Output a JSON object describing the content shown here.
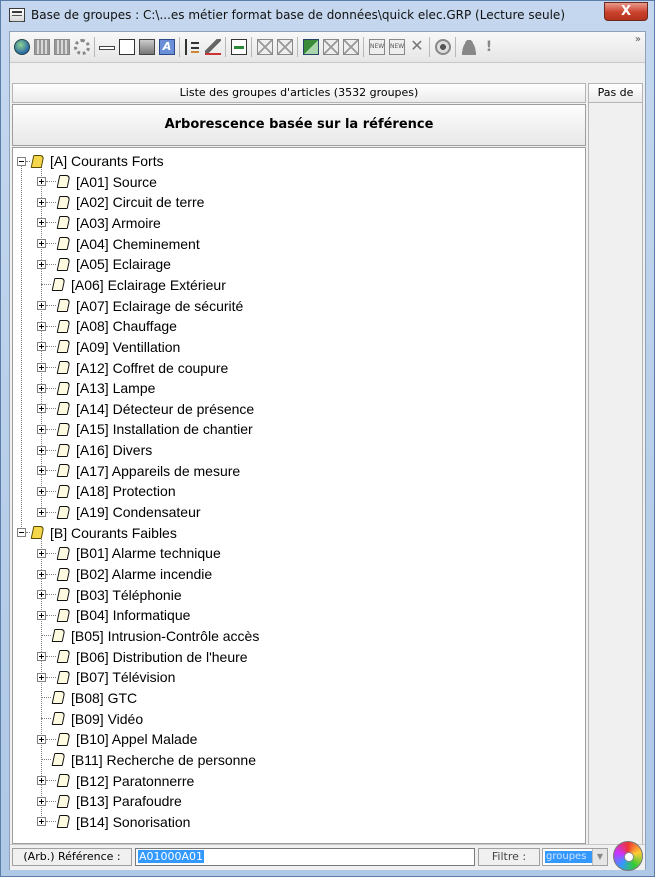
{
  "window": {
    "title": "Base de groupes : C:\\...es métier format base de données\\quick elec.GRP (Lecture seule)",
    "close_label": "X"
  },
  "toolbar": {
    "overflow_label": "»",
    "icons": [
      "globe-icon",
      "group-icon",
      "group-edit-icon",
      "gear-icon",
      "line-icon",
      "box-icon",
      "box-dark-icon",
      "format-icon",
      "tree-icon",
      "edit-icon",
      "export-excel-icon",
      "import-icon",
      "import-alt-icon",
      "excel-icon",
      "disabled-icon",
      "disabled-alt-icon",
      "new-icon",
      "new-alt-icon",
      "delete-icon",
      "view-icon",
      "person-icon",
      "warning-icon"
    ]
  },
  "list": {
    "header": "Liste des groupes d'articles (3532 groupes)",
    "side_header": "Pas de",
    "subtitle": "Arborescence basée sur la référence"
  },
  "tree": {
    "nodes": [
      {
        "label": "[A] Courants Forts",
        "level": 0,
        "expander": "minus"
      },
      {
        "label": "[A01] Source",
        "level": 1,
        "expander": "plus"
      },
      {
        "label": "[A02] Circuit de terre",
        "level": 1,
        "expander": "plus"
      },
      {
        "label": "[A03] Armoire",
        "level": 1,
        "expander": "plus"
      },
      {
        "label": "[A04] Cheminement",
        "level": 1,
        "expander": "plus"
      },
      {
        "label": "[A05] Eclairage",
        "level": 1,
        "expander": "plus"
      },
      {
        "label": "[A06] Eclairage Extérieur",
        "level": 1,
        "expander": "none"
      },
      {
        "label": "[A07] Eclairage de sécurité",
        "level": 1,
        "expander": "plus"
      },
      {
        "label": "[A08] Chauffage",
        "level": 1,
        "expander": "plus"
      },
      {
        "label": "[A09] Ventillation",
        "level": 1,
        "expander": "plus"
      },
      {
        "label": "[A12] Coffret de coupure",
        "level": 1,
        "expander": "plus"
      },
      {
        "label": "[A13] Lampe",
        "level": 1,
        "expander": "plus"
      },
      {
        "label": "[A14] Détecteur de présence",
        "level": 1,
        "expander": "plus"
      },
      {
        "label": "[A15] Installation de chantier",
        "level": 1,
        "expander": "plus"
      },
      {
        "label": "[A16] Divers",
        "level": 1,
        "expander": "plus"
      },
      {
        "label": "[A17] Appareils de mesure",
        "level": 1,
        "expander": "plus"
      },
      {
        "label": "[A18] Protection",
        "level": 1,
        "expander": "plus"
      },
      {
        "label": "[A19] Condensateur",
        "level": 1,
        "expander": "plus"
      },
      {
        "label": "[B] Courants Faibles",
        "level": 0,
        "expander": "minus"
      },
      {
        "label": "[B01] Alarme technique",
        "level": 1,
        "expander": "plus"
      },
      {
        "label": "[B02] Alarme incendie",
        "level": 1,
        "expander": "plus"
      },
      {
        "label": "[B03] Téléphonie",
        "level": 1,
        "expander": "plus"
      },
      {
        "label": "[B04] Informatique",
        "level": 1,
        "expander": "plus"
      },
      {
        "label": "[B05] Intrusion-Contrôle accès",
        "level": 1,
        "expander": "none"
      },
      {
        "label": "[B06] Distribution de l'heure",
        "level": 1,
        "expander": "plus"
      },
      {
        "label": "[B07] Télévision",
        "level": 1,
        "expander": "plus"
      },
      {
        "label": "[B08] GTC",
        "level": 1,
        "expander": "none"
      },
      {
        "label": "[B09] Vidéo",
        "level": 1,
        "expander": "none"
      },
      {
        "label": "[B10] Appel Malade",
        "level": 1,
        "expander": "plus"
      },
      {
        "label": "[B11] Recherche de personne",
        "level": 1,
        "expander": "none"
      },
      {
        "label": "[B12] Paratonnerre",
        "level": 1,
        "expander": "plus"
      },
      {
        "label": "[B13] Parafoudre",
        "level": 1,
        "expander": "plus"
      },
      {
        "label": "[B14] Sonorisation",
        "level": 1,
        "expander": "plus"
      }
    ]
  },
  "status": {
    "ref_label": "(Arb.) Référence :",
    "ref_value": "A01000A01",
    "filter_label": "Filtre :",
    "filter_value": "groupes",
    "dropdown_arrow": "▼"
  }
}
